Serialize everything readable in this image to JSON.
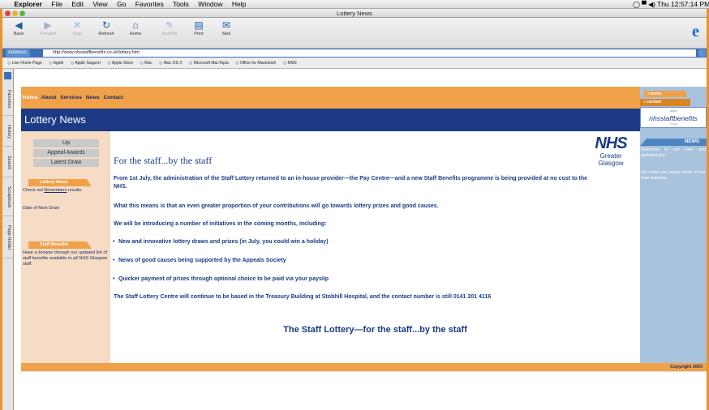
{
  "menubar": {
    "apple": "",
    "items": [
      "Explorer",
      "File",
      "Edit",
      "View",
      "Go",
      "Favorites",
      "Tools",
      "Window",
      "Help"
    ],
    "clock": "Thu 12:57:14 PM"
  },
  "window": {
    "title": "Lottery News"
  },
  "toolbar": {
    "buttons": [
      {
        "label": "Back",
        "icon": "back-arrow-icon"
      },
      {
        "label": "Forward",
        "icon": "forward-arrow-icon"
      },
      {
        "label": "Stop",
        "icon": "stop-x-icon"
      },
      {
        "label": "Refresh",
        "icon": "refresh-icon"
      },
      {
        "label": "Home",
        "icon": "home-icon"
      },
      {
        "label": "AutoFill",
        "icon": "autofill-icon"
      },
      {
        "label": "Print",
        "icon": "print-icon"
      },
      {
        "label": "Mail",
        "icon": "mail-icon"
      }
    ]
  },
  "address": {
    "label": "Address:",
    "url": "http://www.nhsstaffbenefits.co.uk/lottery.htm"
  },
  "favorites": [
    "Live Home Page",
    "Apple",
    "Apple Support",
    "Apple Store",
    "Mac",
    "Mac OS X",
    "Microsoft MacTopia",
    "Office for Macintosh",
    "MSN"
  ],
  "sidetabs": [
    "Favorites",
    "History",
    "Search",
    "Scrapbook",
    "Page Holder"
  ],
  "page": {
    "nav": [
      "Home",
      "About",
      "Services",
      "News",
      "Contact"
    ],
    "title": "Lottery News",
    "left": {
      "buttons": [
        "Up",
        "Appeal Awards",
        "Latest Draw"
      ],
      "lottery_tag": "Lottery News",
      "lottery_text_pre": "Check out ",
      "lottery_link": "Novembers",
      "lottery_text_post": " results.",
      "date_link": "Date of Next Draw",
      "benefits_tag": "Staff Benefits",
      "benefits_text": "Have a browse through our updated list of staff benefits available to all NHS Glasgow staff."
    },
    "main": {
      "heading": "For the staff...by the staff",
      "para1": "From 1st July, the administration of the Staff Lottery returned to an in-house provider—the Pay Centre—and a new Staff Benefits programme is being provided at no cost to the NHS.",
      "para2": "What this means is that an even greater proportion of your contributions will go towards lottery prizes and good causes.",
      "para3": "We will be introducing a number of initiatives in the coming months, including:",
      "bullets": [
        "New and innovative lottery draws and prizes (in July, you could win a holiday)",
        "News of good causes being supported by the Appeals Society",
        "Quicker payment of prizes through optional choice to be paid via your payslip"
      ],
      "para4": "The Staff Lottery Centre will continue to be based in the Treasury Building at Stobhill Hospital, and the contact number is still 0141 201 4116",
      "closing": "The Staff Lottery—for the staff...by the staff"
    },
    "logo": {
      "word": "NHS",
      "sub1": "Greater",
      "sub2": "Glasgow"
    },
    "right": {
      "home": "» home",
      "contact": "» contact",
      "site_small": "www",
      "site_name": "nhsstaffbenefits",
      "site_sub": ".co.uk",
      "news_tag": "NEWS",
      "news1": "Welcome to our new and updated site.",
      "news2": "We hope you enjoy some of our new features."
    },
    "copyright": "Copyright 2003"
  },
  "colors": {
    "orange": "#f0a14a",
    "navy": "#1c3a85",
    "peach": "#f6dcc4",
    "lightblue": "#a7c3dd"
  }
}
